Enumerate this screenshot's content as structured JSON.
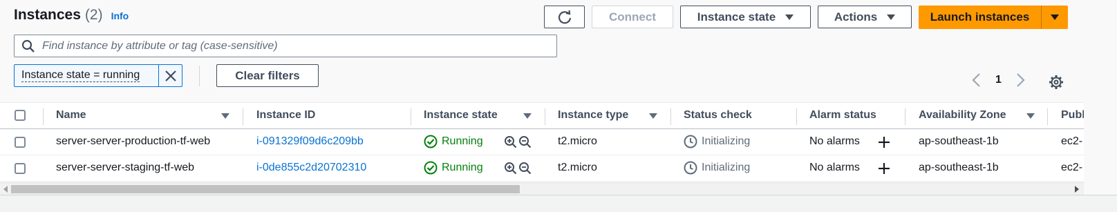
{
  "header": {
    "title": "Instances",
    "count": "(2)",
    "info": "Info"
  },
  "toolbar": {
    "connect": "Connect",
    "instance_state": "Instance state",
    "actions": "Actions",
    "launch": "Launch instances"
  },
  "search": {
    "placeholder": "Find instance by attribute or tag (case-sensitive)"
  },
  "filter": {
    "token": "Instance state = running",
    "clear": "Clear filters"
  },
  "pagination": {
    "page": "1"
  },
  "table": {
    "columns": [
      "Name",
      "Instance ID",
      "Instance state",
      "Instance type",
      "Status check",
      "Alarm status",
      "Availability Zone",
      "Publ"
    ],
    "rows": [
      {
        "name": "server-server-production-tf-web",
        "id": "i-091329f09d6c209bb",
        "state": "Running",
        "type": "t2.micro",
        "status": "Initializing",
        "alarm": "No alarms",
        "az": "ap-southeast-1b",
        "public": "ec2-"
      },
      {
        "name": "server-server-staging-tf-web",
        "id": "i-0de855c2d20702310",
        "state": "Running",
        "type": "t2.micro",
        "status": "Initializing",
        "alarm": "No alarms",
        "az": "ap-southeast-1b",
        "public": "ec2-"
      }
    ]
  },
  "colors": {
    "accent": "#0972d3",
    "launch": "#ff9900",
    "success": "#037f0c"
  }
}
